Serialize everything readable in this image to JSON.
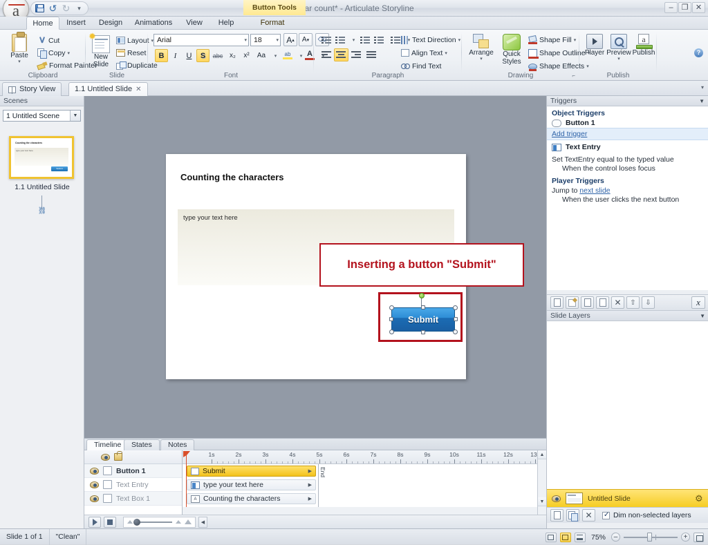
{
  "window": {
    "title": "Char count* - Articulate Storyline",
    "contextual_tab": "Button Tools",
    "minimize": "–",
    "restore": "❐",
    "close": "✕",
    "help": "?"
  },
  "quick_access": {
    "save": "save-icon",
    "undo": "↺",
    "redo": "↻",
    "customize": "▾"
  },
  "ribbon_tabs": [
    {
      "label": "Home",
      "active": true
    },
    {
      "label": "Insert",
      "active": false
    },
    {
      "label": "Design",
      "active": false
    },
    {
      "label": "Animations",
      "active": false
    },
    {
      "label": "View",
      "active": false
    },
    {
      "label": "Help",
      "active": false
    },
    {
      "label": "Format",
      "active": false
    }
  ],
  "ribbon": {
    "clipboard": {
      "title": "Clipboard",
      "paste": "Paste",
      "cut": "Cut",
      "copy": "Copy",
      "format_painter": "Format Painter"
    },
    "slide": {
      "title": "Slide",
      "new_slide": "New\nSlide",
      "new_slide_line1": "New",
      "new_slide_line2": "Slide",
      "layout": "Layout",
      "reset": "Reset",
      "duplicate": "Duplicate"
    },
    "font": {
      "title": "Font",
      "family": "Arial",
      "size": "18",
      "grow": "A",
      "shrink": "A",
      "clear_format": "clear-formatting-icon",
      "bold": "B",
      "italic": "I",
      "underline": "U",
      "shadow": "S",
      "strikethrough": "abc",
      "subscript": "x₂",
      "superscript": "x²",
      "change_case": "Aa",
      "highlight": "highlight-icon",
      "font_color": "A",
      "format_painter_text": "spelling-icon"
    },
    "paragraph": {
      "title": "Paragraph",
      "text_direction": "Text Direction",
      "align_text": "Align Text",
      "find_text": "Find Text"
    },
    "drawing": {
      "title": "Drawing",
      "arrange": "Arrange",
      "quick_styles_line1": "Quick",
      "quick_styles_line2": "Styles",
      "shape_fill": "Shape Fill",
      "shape_outline": "Shape Outline",
      "shape_effects": "Shape Effects"
    },
    "publish": {
      "title": "Publish",
      "player": "Player",
      "preview": "Preview",
      "publish": "Publish"
    }
  },
  "doc_tabs": [
    {
      "label": "Story View",
      "active": false,
      "closable": false
    },
    {
      "label": "1.1 Untitled Slide",
      "active": true,
      "closable": true,
      "close": "✕"
    }
  ],
  "scenes_panel": {
    "title": "Scenes",
    "selected_scene": "1 Untitled Scene",
    "slide_label": "1.1 Untitled Slide",
    "thumb": {
      "title": "Counting the characters",
      "field_text": "type your text here",
      "button": "Submit"
    }
  },
  "slide": {
    "title": "Counting the characters",
    "text_entry_placeholder": "type your text here",
    "button_label": "Submit",
    "annotation": "Inserting a button \"Submit\""
  },
  "triggers_panel": {
    "title": "Triggers",
    "object_triggers_heading": "Object Triggers",
    "button_object": "Button 1",
    "add_trigger": "Add trigger",
    "text_entry_object": "Text Entry",
    "text_entry_action": "Set TextEntry equal to the typed value",
    "text_entry_condition": "When the control loses focus",
    "player_triggers_heading": "Player Triggers",
    "player_action_prefix": "Jump to ",
    "player_action_link": "next slide",
    "player_condition": "When the user clicks the next button",
    "toolbar": {
      "new": "new-trigger-icon",
      "edit": "edit-trigger-icon",
      "copy": "copy-trigger-icon",
      "paste": "paste-trigger-icon",
      "delete": "✕",
      "move_up": "⇧",
      "move_down": "⇩",
      "variables": "x"
    }
  },
  "slide_layers_panel": {
    "title": "Slide Layers",
    "base_layer": "Untitled Slide",
    "dim_label": "Dim non-selected layers",
    "dim_checked": true,
    "new_layer": "new-layer-icon",
    "duplicate_layer": "duplicate-layer-icon",
    "delete_layer": "✕",
    "settings": "⚙"
  },
  "timeline": {
    "tabs": [
      {
        "label": "Timeline",
        "active": true
      },
      {
        "label": "States",
        "active": false
      },
      {
        "label": "Notes",
        "active": false
      }
    ],
    "ruler_labels": [
      "1s",
      "2s",
      "3s",
      "4s",
      "5s",
      "6s",
      "7s",
      "8s",
      "9s",
      "10s",
      "11s",
      "12s",
      "13"
    ],
    "end_label": "End",
    "rows": [
      {
        "name": "Button 1",
        "bar": "Submit",
        "selected": true,
        "icon": "button-icon"
      },
      {
        "name": "Text Entry",
        "bar": "type your text here",
        "selected": false,
        "icon": "text-entry-icon"
      },
      {
        "name": "Text Box 1",
        "bar": "Counting the characters",
        "selected": false,
        "icon": "text-box-icon"
      }
    ],
    "controls": {
      "play": "▶",
      "stop": "■",
      "zoom_out": "zoom-out-icon",
      "zoom_in": "zoom-in-icon"
    }
  },
  "status_bar": {
    "slide_count": "Slide 1 of 1",
    "theme": "\"Clean\"",
    "zoom_level": "75%",
    "zoom_out": "–",
    "zoom_in": "+",
    "view_normal": "normal-view-icon",
    "view_split": "split-view-icon",
    "view_list": "list-view-icon",
    "fit_to_window": "fit-to-window-icon"
  },
  "colors": {
    "accent_yellow": "#f6cd24",
    "annotation_red": "#b3121d",
    "button_blue": "#1b6cb4",
    "link_blue": "#2e63a8",
    "canvas_gray": "#929aa6"
  }
}
